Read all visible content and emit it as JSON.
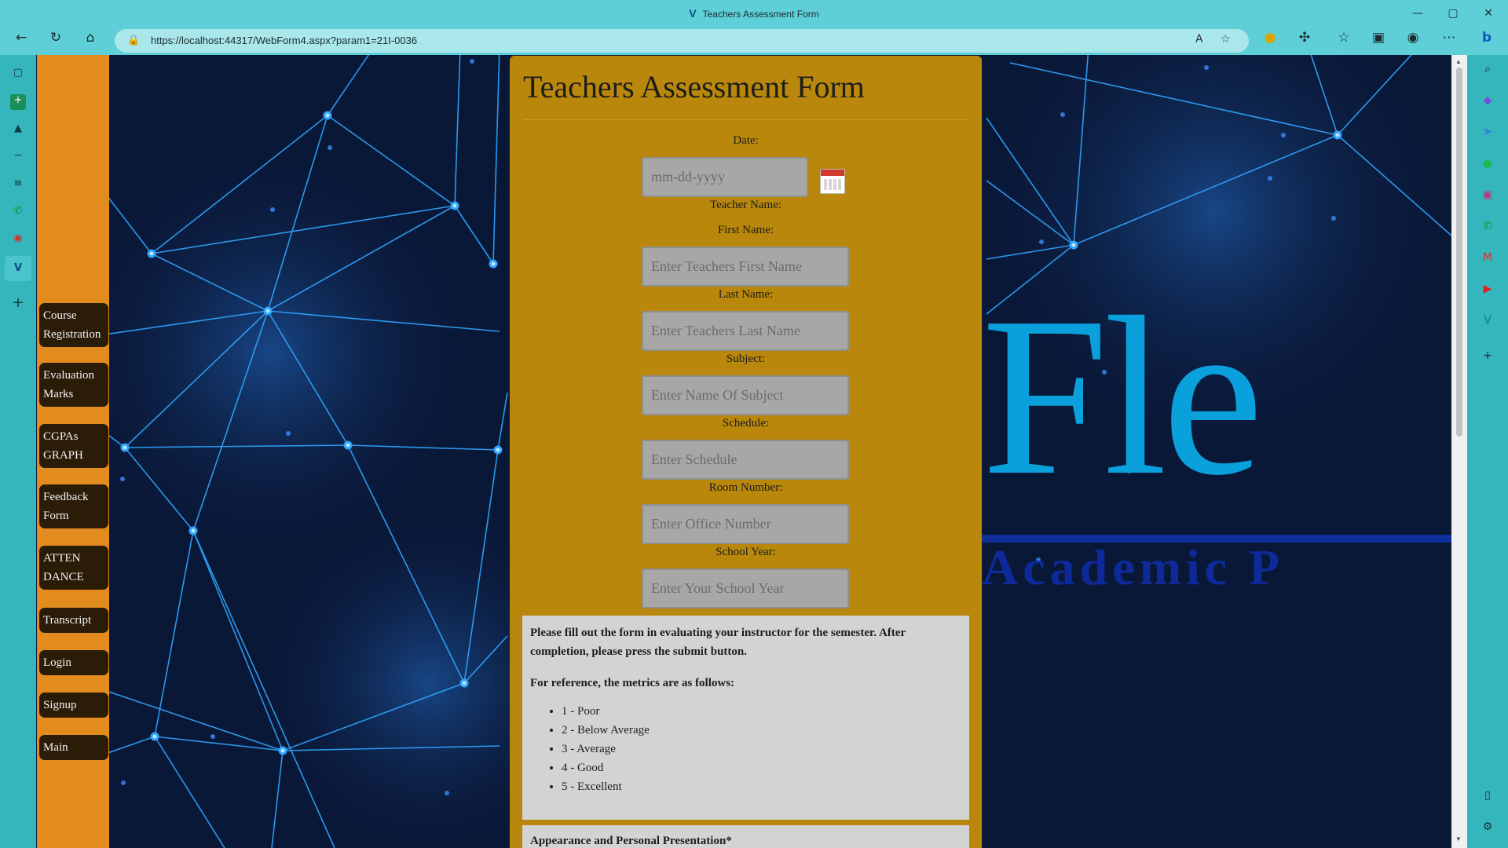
{
  "window": {
    "title": "Teachers Assessment Form",
    "controls": [
      "—",
      "▢",
      "✕"
    ]
  },
  "toolbar": {
    "url": "https://localhost:44317/WebForm4.aspx?param1=21I-0036"
  },
  "nav": {
    "items": [
      {
        "label": "Course Registration"
      },
      {
        "label": "Evaluation Marks"
      },
      {
        "label": "CGPAs GRAPH"
      },
      {
        "label": "Feedback Form"
      },
      {
        "label": "ATTEN DANCE"
      },
      {
        "label": "Transcript"
      },
      {
        "label": "Login"
      },
      {
        "label": "Signup"
      },
      {
        "label": "Main"
      }
    ]
  },
  "form": {
    "title": "Teachers Assessment Form",
    "date_label": "Date:",
    "date_placeholder": "mm-dd-yyyy",
    "teacher_name_label": "Teacher Name:",
    "first_name_label": "First Name:",
    "first_name_placeholder": "Enter Teachers First Name",
    "last_name_label": "Last Name:",
    "last_name_placeholder": "Enter Teachers Last Name",
    "subject_label": "Subject:",
    "subject_placeholder": "Enter Name Of Subject",
    "schedule_label": "Schedule:",
    "schedule_placeholder": "Enter Schedule",
    "room_label": "Room Number:",
    "room_placeholder": "Enter Office Number",
    "year_label": "School Year:",
    "year_placeholder": "Enter Your School Year"
  },
  "info": {
    "intro": "Please fill out the form in evaluating your instructor for the semester. After completion, please press the submit button.",
    "reference": "For reference, the metrics are as follows:",
    "metrics": [
      "1 - Poor",
      "2 - Below Average",
      "3 - Average",
      "4 - Good",
      "5 - Excellent"
    ],
    "section": "Appearance and Personal Presentation*"
  },
  "background": {
    "big_text": "Fle",
    "sub_text": "Academic P"
  },
  "colors": {
    "chrome": "#5ecfd6",
    "nav": "#e28b1f",
    "nav_button": "#2a1c07",
    "card": "#b8870b",
    "info_panel": "#d3d3d3",
    "network_lines": "#2fa6ff",
    "logo_text": "#0aa0dc"
  }
}
